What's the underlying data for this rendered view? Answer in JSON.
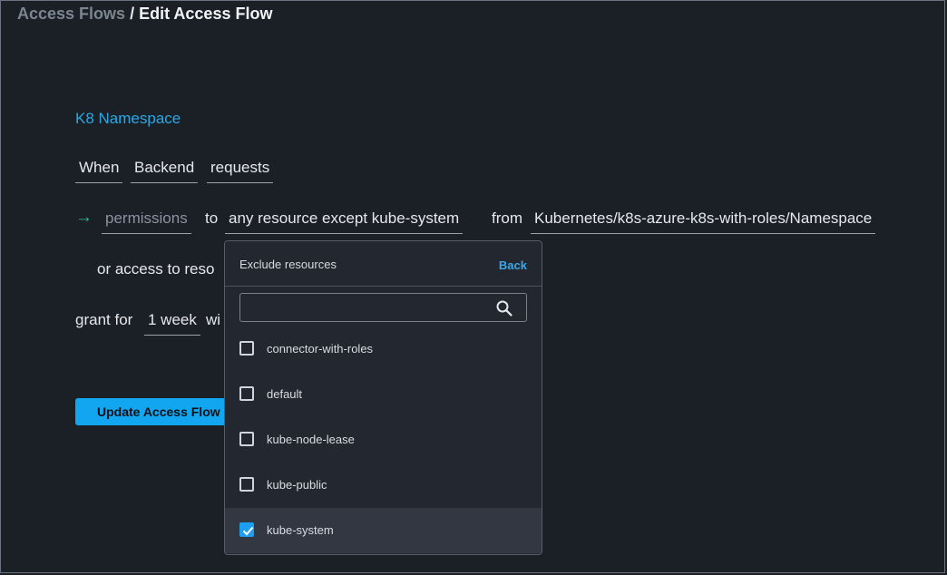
{
  "breadcrumb": {
    "parent": "Access Flows",
    "separator": "/",
    "current": "Edit Access Flow"
  },
  "flow": {
    "title": "K8 Namespace",
    "when": "When",
    "group": "Backend",
    "requests": "requests",
    "permissions": "permissions",
    "to": "to",
    "resource": "any resource except kube-system",
    "from": "from",
    "integration": "Kubernetes/k8s-azure-k8s-with-roles/Namespace",
    "or_access": "or access to reso",
    "grant_for": "grant for",
    "duration": "1 week",
    "with_trunc": "wi"
  },
  "actions": {
    "update_label": "Update Access Flow"
  },
  "dropdown": {
    "title": "Exclude resources",
    "back_label": "Back",
    "search_value": "",
    "search_placeholder": "",
    "options": [
      {
        "label": "connector-with-roles",
        "checked": false
      },
      {
        "label": "default",
        "checked": false
      },
      {
        "label": "kube-node-lease",
        "checked": false
      },
      {
        "label": "kube-public",
        "checked": false
      },
      {
        "label": "kube-system",
        "checked": true
      }
    ]
  },
  "colors": {
    "background": "#1b1f26",
    "accent": "#12a5f0",
    "link": "#28a9e6",
    "arrow": "#2fbf9c"
  },
  "icons": {
    "arrow": "arrow-right-icon",
    "search": "search-icon",
    "check": "checkmark-icon"
  }
}
